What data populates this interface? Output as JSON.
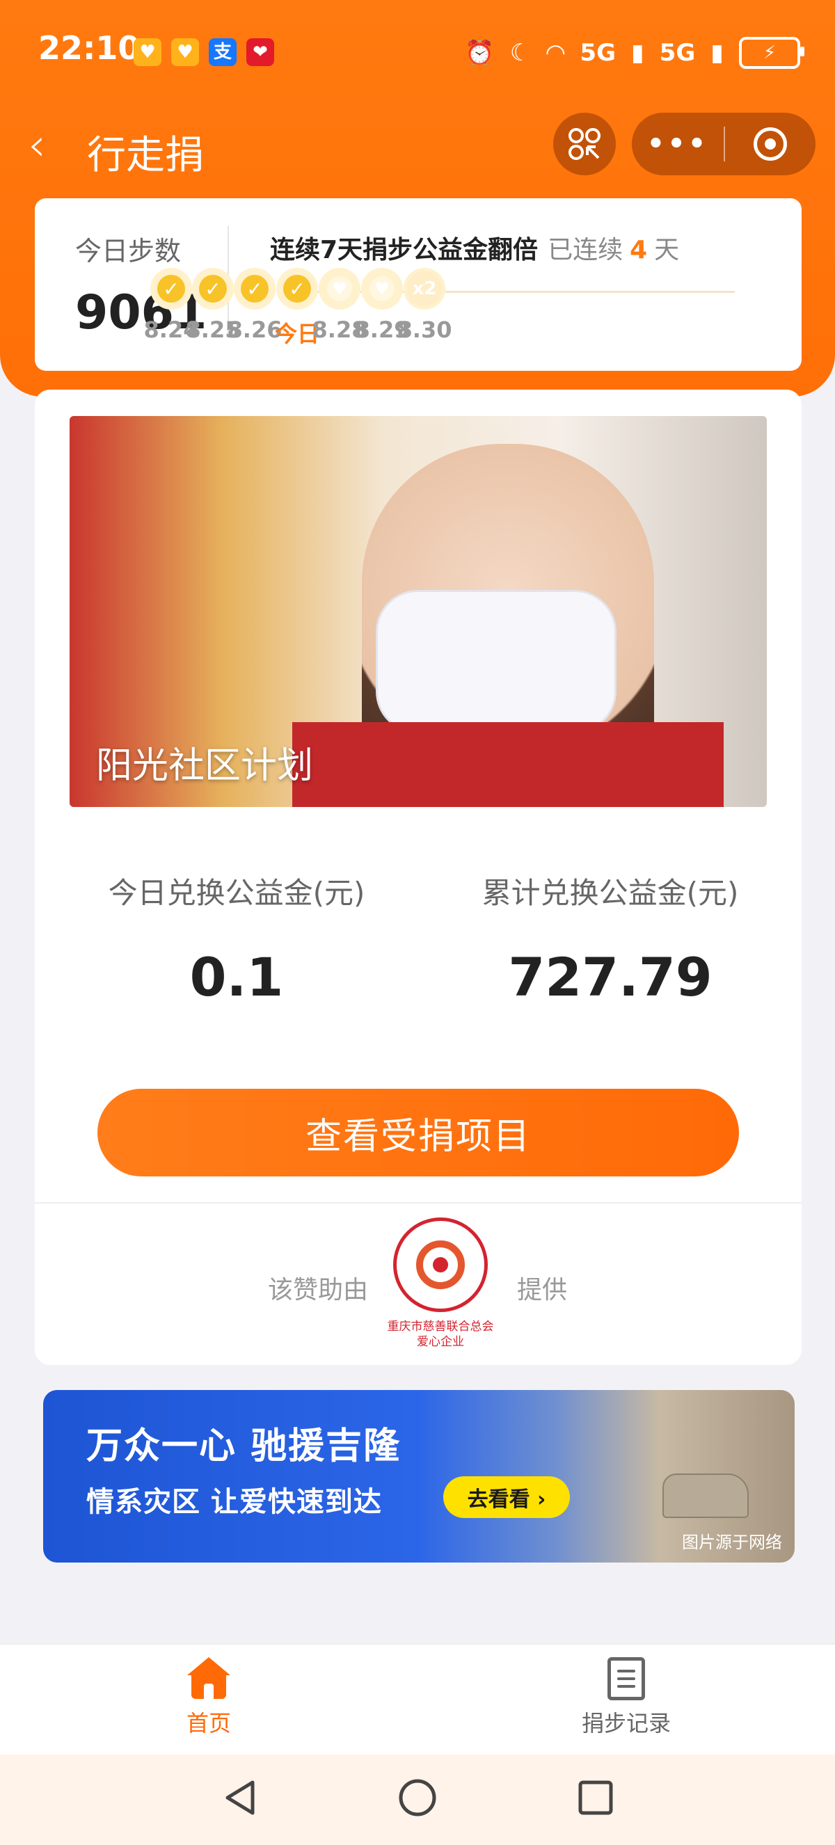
{
  "status_bar": {
    "time": "22:10",
    "network_1": "5G",
    "network_2": "5G",
    "battery_icon": "battery-charging-icon"
  },
  "nav": {
    "title": "行走捐",
    "back_icon": "chevron-left-icon",
    "scan_icon": "scan-code-icon",
    "more_icon": "more-dots-icon",
    "close_icon": "target-circle-icon"
  },
  "steps": {
    "label": "今日步数",
    "value": "9061",
    "streak_title": "连续7天捐步公益金翻倍",
    "streak_prefix": "已连续",
    "streak_days": "4",
    "streak_suffix": "天",
    "days": [
      {
        "label": "8.24",
        "state": "done",
        "mark": "✓"
      },
      {
        "label": "8.25",
        "state": "done",
        "mark": "✓"
      },
      {
        "label": "8.26",
        "state": "done",
        "mark": "✓"
      },
      {
        "label": "今日",
        "state": "done",
        "mark": "✓"
      },
      {
        "label": "8.28",
        "state": "todo",
        "mark": "♥"
      },
      {
        "label": "8.29",
        "state": "todo",
        "mark": "♥"
      },
      {
        "label": "8.30",
        "state": "bonus",
        "mark": "x2"
      }
    ]
  },
  "project": {
    "banner_title": "阳光社区计划",
    "today_label": "今日兑换公益金(元)",
    "today_value": "0.1",
    "total_label": "累计兑换公益金(元)",
    "total_value": "727.79",
    "cta_label": "查看受捐项目",
    "sponsor_prefix": "该赞助由",
    "sponsor_suffix": "提供",
    "sponsor_name": "重庆市慈善联合总会",
    "sponsor_caption": "爱心企业"
  },
  "ad": {
    "headline": "万众一心 驰援吉隆",
    "subline": "情系灾区 让爱快速到达",
    "button": "去看看 ›",
    "credit": "图片源于网络"
  },
  "tabs": [
    {
      "label": "首页",
      "icon": "home-icon",
      "active": true
    },
    {
      "label": "捐步记录",
      "icon": "record-list-icon",
      "active": false
    }
  ],
  "colors": {
    "brand": "#ff6a07",
    "streak_dot": "#f8c328",
    "ad_blue": "#2c66e8",
    "ad_button": "#ffe100"
  }
}
